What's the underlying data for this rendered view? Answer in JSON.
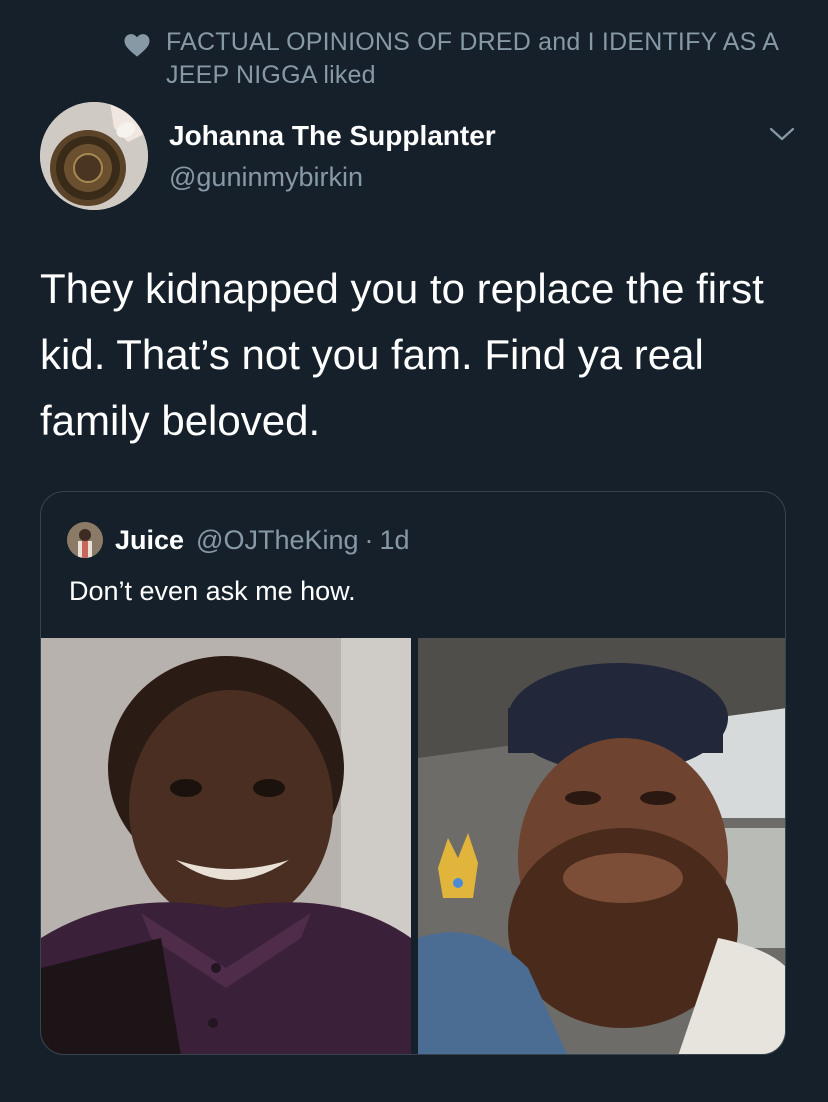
{
  "social_context": {
    "icon": "heart-icon",
    "text": "FACTUAL OPINIONS OF DRED and I IDENTIFY AS A JEEP NIGGA liked"
  },
  "tweet": {
    "author_name": "Johanna The Supplanter",
    "author_handle": "@guninmybirkin",
    "text": "They kidnapped you to replace the first kid. That’s not you fam. Find ya real family beloved."
  },
  "quoted_tweet": {
    "author_name": "Juice",
    "author_handle": "@OJTheKing",
    "separator": "·",
    "time": "1d",
    "text": "Don’t even ask me how."
  },
  "colors": {
    "background": "#15202b",
    "secondary_text": "#8899a6",
    "border": "#38444d"
  }
}
